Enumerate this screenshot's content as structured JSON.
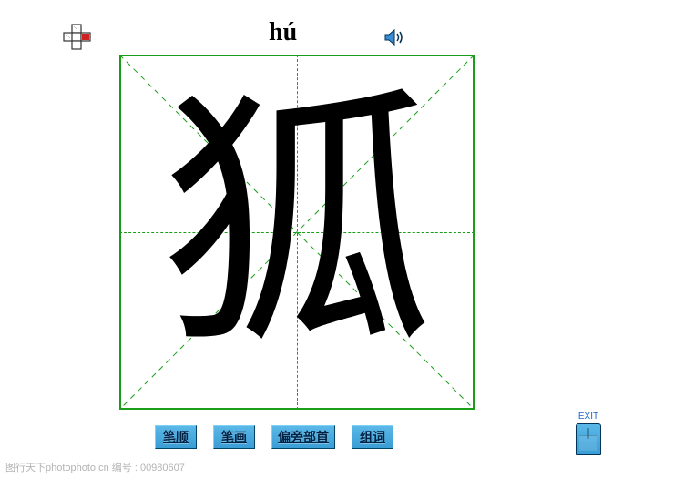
{
  "pinyin": "hú",
  "character": "狐",
  "buttons": {
    "stroke_order": "笔顺",
    "strokes": "笔画",
    "radical": "偏旁部首",
    "words": "组词"
  },
  "exit_label": "EXIT",
  "watermark": "图行天下photophoto.cn  编号 : 00980607",
  "icons": {
    "puzzle": "puzzle-icon",
    "speaker": "speaker-icon"
  }
}
